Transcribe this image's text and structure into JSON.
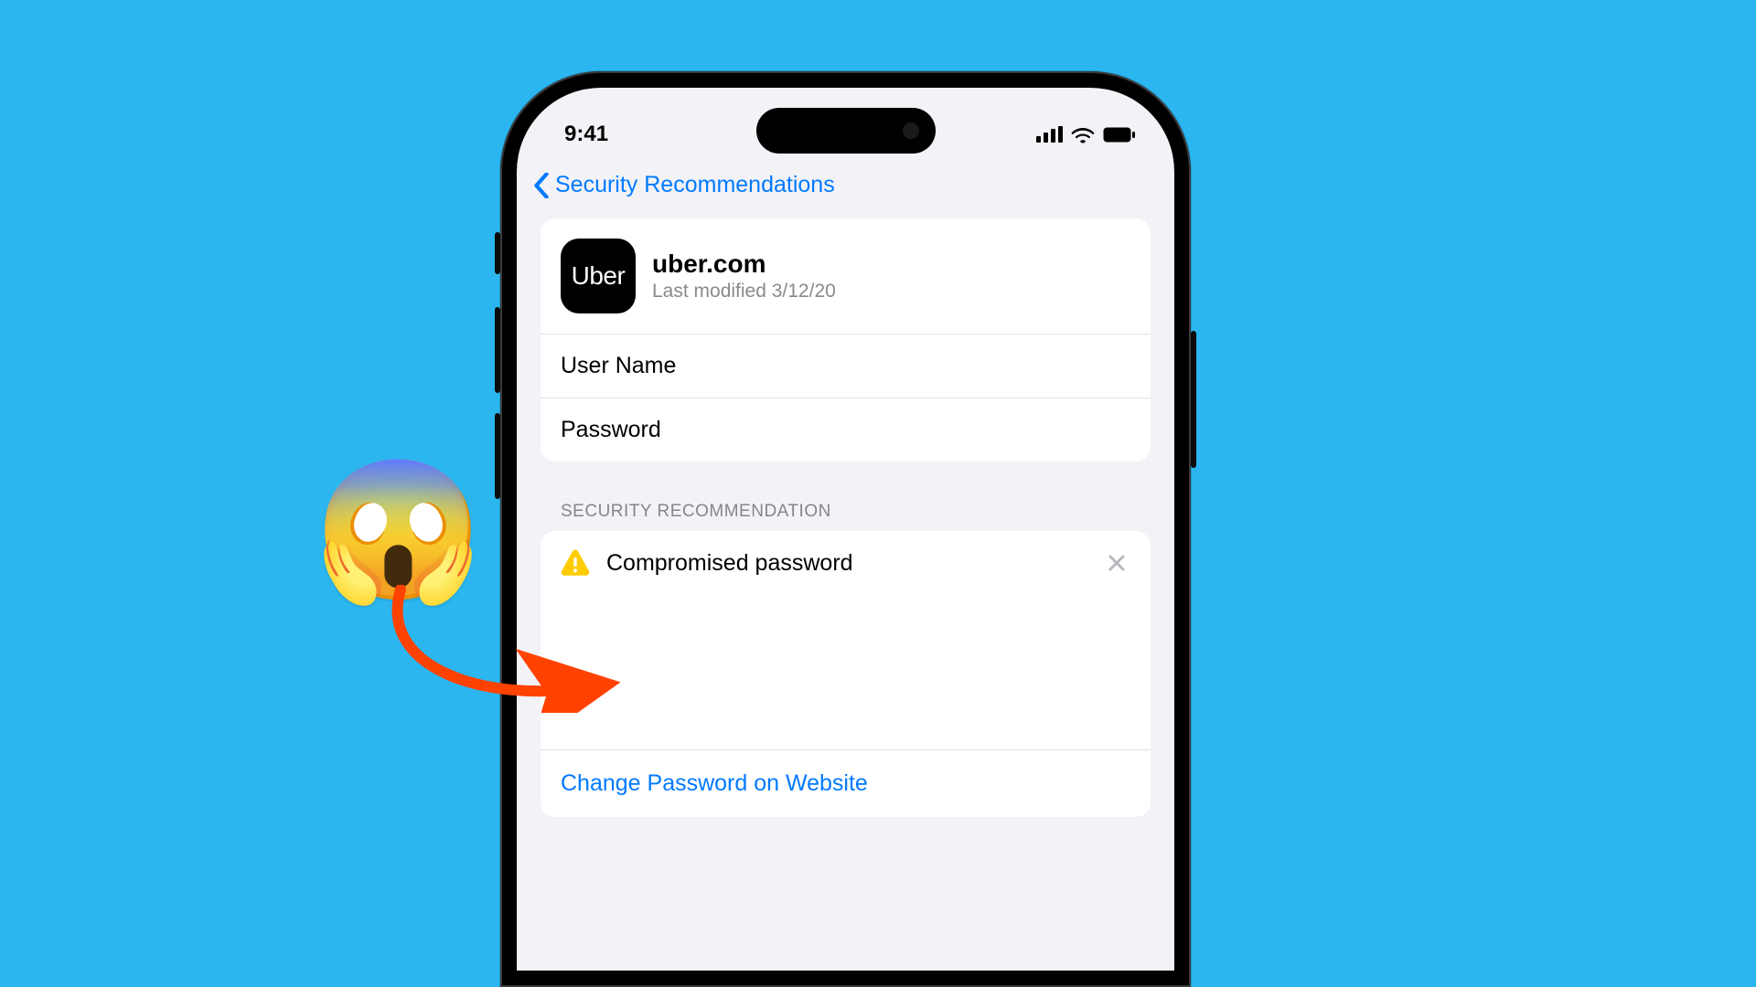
{
  "status": {
    "time": "9:41"
  },
  "nav": {
    "back_label": "Security Recommendations"
  },
  "site": {
    "icon_text": "Uber",
    "domain": "uber.com",
    "modified": "Last modified 3/12/20"
  },
  "fields": {
    "username_label": "User Name",
    "password_label": "Password"
  },
  "section": {
    "header": "SECURITY RECOMMENDATION"
  },
  "recommendation": {
    "title": "Compromised password",
    "action": "Change Password on Website"
  },
  "overlay": {
    "emoji": "😱"
  }
}
